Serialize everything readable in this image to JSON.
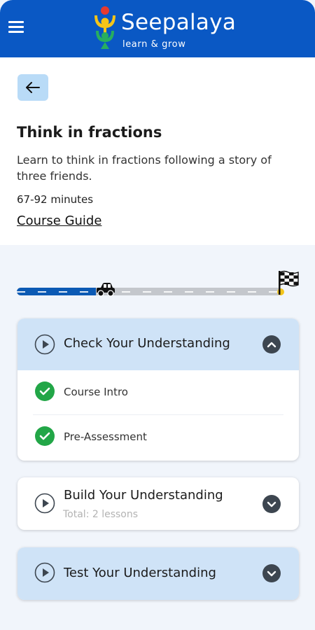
{
  "header": {
    "brand_name": "Seepalaya",
    "tagline": "learn & grow",
    "colors": {
      "bar": "#0a58c4",
      "logo_red": "#e53a2f",
      "logo_yellow": "#f5c518",
      "logo_green": "#27ae60"
    }
  },
  "course": {
    "title": "Think in fractions",
    "description": "Learn to think in fractions following a story of three friends.",
    "duration": "67-92 minutes",
    "guide_link": "Course Guide"
  },
  "progress": {
    "fraction": 0.3,
    "icons": [
      "car-icon",
      "checkered-flag-icon"
    ]
  },
  "sections": [
    {
      "title": "Check Your Understanding",
      "subtitle": "",
      "expanded": true,
      "lessons": [
        {
          "label": "Course Intro",
          "completed": true
        },
        {
          "label": "Pre-Assessment",
          "completed": true
        }
      ]
    },
    {
      "title": "Build Your Understanding",
      "subtitle": "Total: 2 lessons",
      "expanded": false
    },
    {
      "title": "Test Your Understanding",
      "subtitle": "",
      "expanded": false
    }
  ],
  "colors": {
    "accent": "#0c5ab4",
    "section_header": "#cfe3f7",
    "check_green": "#22a647",
    "back_button": "#b9dbf7"
  }
}
